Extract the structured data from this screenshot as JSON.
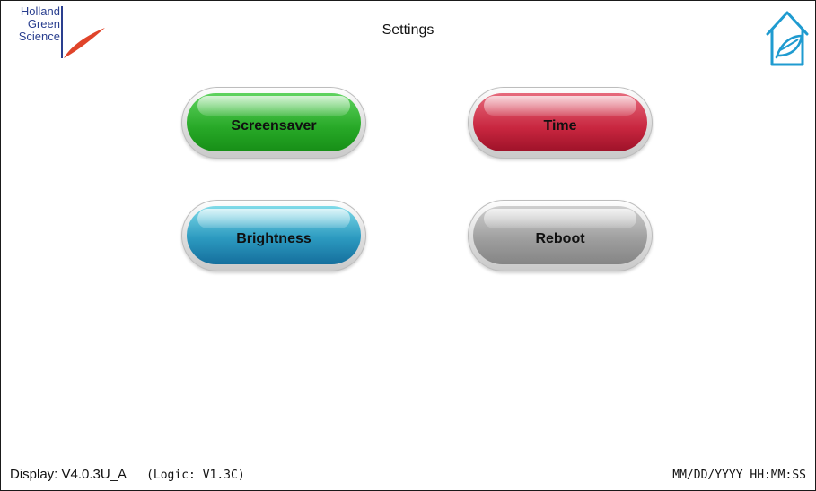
{
  "brand": {
    "logo_lines": [
      "Holland",
      "Green",
      "Science"
    ],
    "accent_blue": "#2a3f8f",
    "accent_red": "#e0442a"
  },
  "header": {
    "title": "Settings",
    "home_icon": "home-leaf-icon"
  },
  "buttons": [
    {
      "label": "Screensaver",
      "color": "green"
    },
    {
      "label": "Time",
      "color": "red"
    },
    {
      "label": "Brightness",
      "color": "blue"
    },
    {
      "label": "Reboot",
      "color": "gray"
    }
  ],
  "footer": {
    "display_version": "Display: V4.0.3U_A",
    "logic_version": "(Logic: V1.3C)",
    "datetime": "MM/DD/YYYY HH:MM:SS"
  }
}
